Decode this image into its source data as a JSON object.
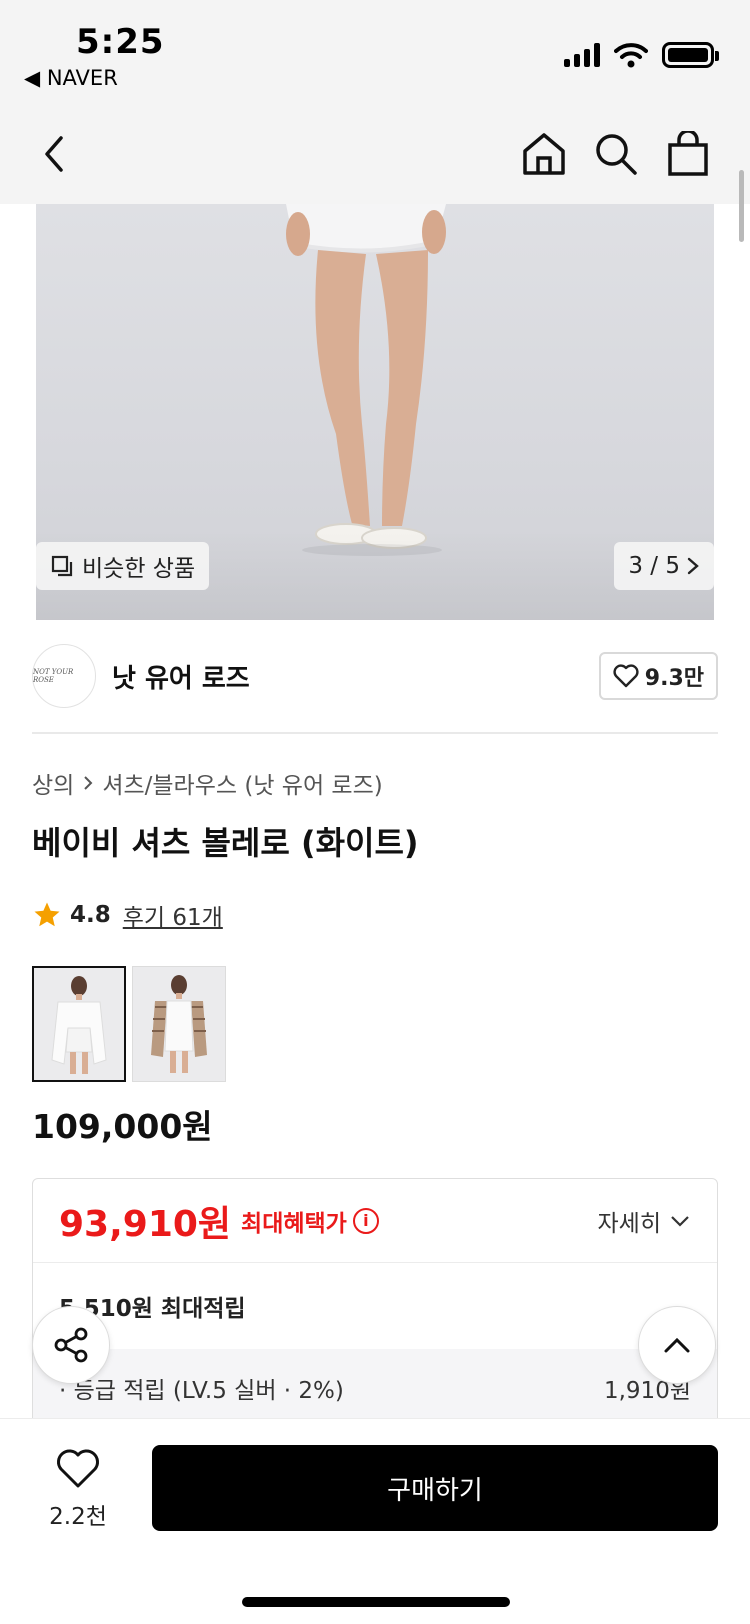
{
  "status_bar": {
    "time": "5:25",
    "back_app": "◀ NAVER"
  },
  "header": {
    "icons": [
      "chevron-left-icon",
      "home-icon",
      "search-icon",
      "shopping-bag-icon"
    ]
  },
  "hero": {
    "similar_label": "비슷한 상품",
    "page_indicator": "3 / 5"
  },
  "brand": {
    "name": "낫 유어 로즈",
    "logo_text": "NOT YOUR ROSE",
    "followers": "9.3만"
  },
  "breadcrumb": {
    "level1": "상의",
    "level2": "셔츠/블라우스 (낫 유어 로즈)"
  },
  "product": {
    "title": "베이비 셔츠 볼레로 (화이트)",
    "rating": "4.8",
    "review_text": "후기 61개",
    "price": "109,000원"
  },
  "benefit": {
    "max_price": "93,910원",
    "max_label": "최대혜택가",
    "detail_label": "자세히",
    "reward_title": "5,510원 최대적립",
    "reward_row_label": "· 등급 적립 (LV.5 실버 · 2%)",
    "reward_row_value": "1,910원"
  },
  "bottom": {
    "wish_count": "2.2천",
    "buy_label": "구매하기"
  },
  "colors": {
    "accent_red": "#ea1a1a",
    "star": "#f5a000",
    "buy_bg": "#000000"
  }
}
